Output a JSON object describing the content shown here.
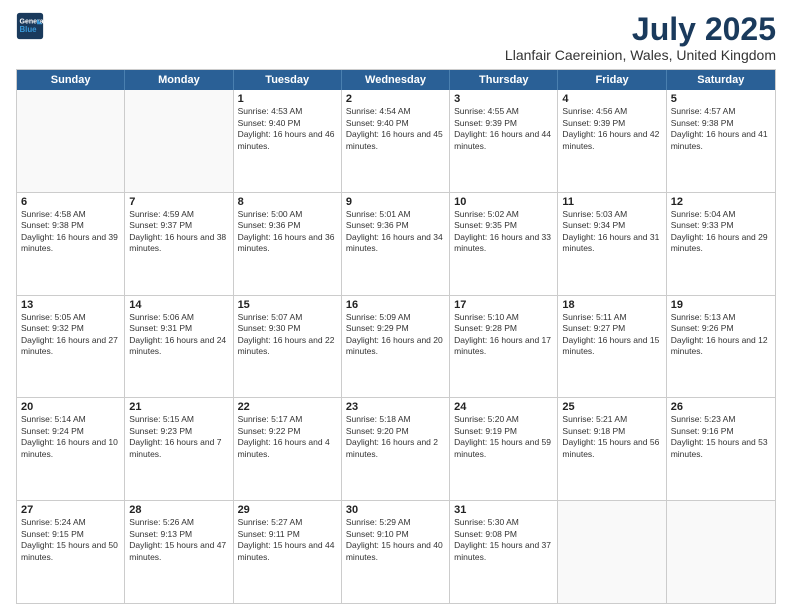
{
  "header": {
    "logo_line1": "General",
    "logo_line2": "Blue",
    "title": "July 2025",
    "subtitle": "Llanfair Caereinion, Wales, United Kingdom"
  },
  "weekdays": [
    "Sunday",
    "Monday",
    "Tuesday",
    "Wednesday",
    "Thursday",
    "Friday",
    "Saturday"
  ],
  "weeks": [
    [
      {
        "day": "",
        "info": ""
      },
      {
        "day": "",
        "info": ""
      },
      {
        "day": "1",
        "info": "Sunrise: 4:53 AM\nSunset: 9:40 PM\nDaylight: 16 hours and 46 minutes."
      },
      {
        "day": "2",
        "info": "Sunrise: 4:54 AM\nSunset: 9:40 PM\nDaylight: 16 hours and 45 minutes."
      },
      {
        "day": "3",
        "info": "Sunrise: 4:55 AM\nSunset: 9:39 PM\nDaylight: 16 hours and 44 minutes."
      },
      {
        "day": "4",
        "info": "Sunrise: 4:56 AM\nSunset: 9:39 PM\nDaylight: 16 hours and 42 minutes."
      },
      {
        "day": "5",
        "info": "Sunrise: 4:57 AM\nSunset: 9:38 PM\nDaylight: 16 hours and 41 minutes."
      }
    ],
    [
      {
        "day": "6",
        "info": "Sunrise: 4:58 AM\nSunset: 9:38 PM\nDaylight: 16 hours and 39 minutes."
      },
      {
        "day": "7",
        "info": "Sunrise: 4:59 AM\nSunset: 9:37 PM\nDaylight: 16 hours and 38 minutes."
      },
      {
        "day": "8",
        "info": "Sunrise: 5:00 AM\nSunset: 9:36 PM\nDaylight: 16 hours and 36 minutes."
      },
      {
        "day": "9",
        "info": "Sunrise: 5:01 AM\nSunset: 9:36 PM\nDaylight: 16 hours and 34 minutes."
      },
      {
        "day": "10",
        "info": "Sunrise: 5:02 AM\nSunset: 9:35 PM\nDaylight: 16 hours and 33 minutes."
      },
      {
        "day": "11",
        "info": "Sunrise: 5:03 AM\nSunset: 9:34 PM\nDaylight: 16 hours and 31 minutes."
      },
      {
        "day": "12",
        "info": "Sunrise: 5:04 AM\nSunset: 9:33 PM\nDaylight: 16 hours and 29 minutes."
      }
    ],
    [
      {
        "day": "13",
        "info": "Sunrise: 5:05 AM\nSunset: 9:32 PM\nDaylight: 16 hours and 27 minutes."
      },
      {
        "day": "14",
        "info": "Sunrise: 5:06 AM\nSunset: 9:31 PM\nDaylight: 16 hours and 24 minutes."
      },
      {
        "day": "15",
        "info": "Sunrise: 5:07 AM\nSunset: 9:30 PM\nDaylight: 16 hours and 22 minutes."
      },
      {
        "day": "16",
        "info": "Sunrise: 5:09 AM\nSunset: 9:29 PM\nDaylight: 16 hours and 20 minutes."
      },
      {
        "day": "17",
        "info": "Sunrise: 5:10 AM\nSunset: 9:28 PM\nDaylight: 16 hours and 17 minutes."
      },
      {
        "day": "18",
        "info": "Sunrise: 5:11 AM\nSunset: 9:27 PM\nDaylight: 16 hours and 15 minutes."
      },
      {
        "day": "19",
        "info": "Sunrise: 5:13 AM\nSunset: 9:26 PM\nDaylight: 16 hours and 12 minutes."
      }
    ],
    [
      {
        "day": "20",
        "info": "Sunrise: 5:14 AM\nSunset: 9:24 PM\nDaylight: 16 hours and 10 minutes."
      },
      {
        "day": "21",
        "info": "Sunrise: 5:15 AM\nSunset: 9:23 PM\nDaylight: 16 hours and 7 minutes."
      },
      {
        "day": "22",
        "info": "Sunrise: 5:17 AM\nSunset: 9:22 PM\nDaylight: 16 hours and 4 minutes."
      },
      {
        "day": "23",
        "info": "Sunrise: 5:18 AM\nSunset: 9:20 PM\nDaylight: 16 hours and 2 minutes."
      },
      {
        "day": "24",
        "info": "Sunrise: 5:20 AM\nSunset: 9:19 PM\nDaylight: 15 hours and 59 minutes."
      },
      {
        "day": "25",
        "info": "Sunrise: 5:21 AM\nSunset: 9:18 PM\nDaylight: 15 hours and 56 minutes."
      },
      {
        "day": "26",
        "info": "Sunrise: 5:23 AM\nSunset: 9:16 PM\nDaylight: 15 hours and 53 minutes."
      }
    ],
    [
      {
        "day": "27",
        "info": "Sunrise: 5:24 AM\nSunset: 9:15 PM\nDaylight: 15 hours and 50 minutes."
      },
      {
        "day": "28",
        "info": "Sunrise: 5:26 AM\nSunset: 9:13 PM\nDaylight: 15 hours and 47 minutes."
      },
      {
        "day": "29",
        "info": "Sunrise: 5:27 AM\nSunset: 9:11 PM\nDaylight: 15 hours and 44 minutes."
      },
      {
        "day": "30",
        "info": "Sunrise: 5:29 AM\nSunset: 9:10 PM\nDaylight: 15 hours and 40 minutes."
      },
      {
        "day": "31",
        "info": "Sunrise: 5:30 AM\nSunset: 9:08 PM\nDaylight: 15 hours and 37 minutes."
      },
      {
        "day": "",
        "info": ""
      },
      {
        "day": "",
        "info": ""
      }
    ]
  ]
}
